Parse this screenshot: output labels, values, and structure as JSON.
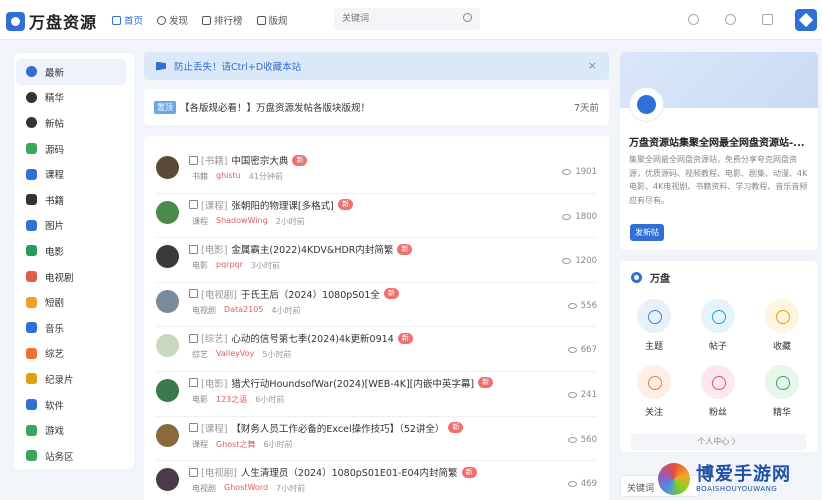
{
  "header": {
    "logo_text": "万盘资源",
    "nav": [
      {
        "label": "首页",
        "icon": "home-icon",
        "active": true
      },
      {
        "label": "发现",
        "icon": "compass-icon"
      },
      {
        "label": "排行榜",
        "icon": "ranking-icon"
      },
      {
        "label": "版规",
        "icon": "rules-icon"
      }
    ],
    "search_placeholder": "关键词",
    "icons": [
      "bell-icon",
      "search-icon",
      "edit-icon",
      "user-avatar-icon"
    ]
  },
  "sidebar": {
    "items": [
      {
        "label": "最新",
        "active": true,
        "color": "#2f6fd6"
      },
      {
        "label": "精华",
        "color": "#333333"
      },
      {
        "label": "新帖",
        "color": "#333333"
      },
      {
        "label": "源码",
        "color": "#3aa55d"
      },
      {
        "label": "课程",
        "color": "#2f6fd6"
      },
      {
        "label": "书籍",
        "color": "#333333"
      },
      {
        "label": "图片",
        "color": "#2f6fd6"
      },
      {
        "label": "电影",
        "color": "#2c9b5a"
      },
      {
        "label": "电视剧",
        "color": "#e25b4b"
      },
      {
        "label": "短剧",
        "color": "#f0a020"
      },
      {
        "label": "音乐",
        "color": "#2f6fd6"
      },
      {
        "label": "综艺",
        "color": "#f07030"
      },
      {
        "label": "纪录片",
        "color": "#e0a010"
      },
      {
        "label": "软件",
        "color": "#2f6fd6"
      },
      {
        "label": "游戏",
        "color": "#3aa55d"
      },
      {
        "label": "站务区",
        "color": "#3aa55d"
      }
    ]
  },
  "notice": {
    "text": "防止丢失！请Ctrl+D收藏本站",
    "close": "×"
  },
  "announcement": {
    "tag": "置顶",
    "text": "【各版规必看！】万盘资源发帖各版块版规！",
    "time": "7天前"
  },
  "posts": [
    {
      "category": "[书籍]",
      "title": "中国密宗大典",
      "badge": "新",
      "section": "书籍",
      "author": "ghistu",
      "time": "41分钟前",
      "views": "1901",
      "avatar_color": "#5a4a3a"
    },
    {
      "category": "[课程]",
      "title": "张朝阳的物理课[多格式]",
      "badge": "新",
      "section": "课程",
      "author": "ShadowWing",
      "time": "2小时前",
      "views": "1800",
      "avatar_color": "#4a8a4a"
    },
    {
      "category": "[电影]",
      "title": "金属霸主(2022)4KDV&HDR内封简繁",
      "badge": "新",
      "section": "电影",
      "author": "pqrpqr",
      "time": "3小时前",
      "views": "1200",
      "avatar_color": "#3a3a3a"
    },
    {
      "category": "[电视剧]",
      "title": "于氏王后（2024）1080pS01全",
      "badge": "新",
      "section": "电视剧",
      "author": "Data2105",
      "time": "4小时前",
      "views": "556",
      "avatar_color": "#7a8a9a"
    },
    {
      "category": "[综艺]",
      "title": "心动的信号第七季(2024)4k更新0914",
      "badge": "新",
      "section": "综艺",
      "author": "ValleyVoy",
      "time": "5小时前",
      "views": "667",
      "avatar_color": "#c8d8c0"
    },
    {
      "category": "[电影]",
      "title": "猎犬行动HoundsofWar(2024)[WEB-4K][内嵌中英字幕]",
      "badge": "新",
      "section": "电影",
      "author": "123之语",
      "time": "6小时前",
      "views": "241",
      "avatar_color": "#3a7a4a"
    },
    {
      "category": "[课程]",
      "title": "【财务人员工作必备的Excel操作技巧】（52讲全）",
      "badge": "新",
      "section": "课程",
      "author": "Ghost之舞",
      "time": "6小时前",
      "views": "560",
      "avatar_color": "#8a6a3a"
    },
    {
      "category": "[电视剧]",
      "title": "人生清理员（2024）1080pS01E01-E04内封简繁",
      "badge": "新",
      "section": "电视剧",
      "author": "GhostWord",
      "time": "7小时前",
      "views": "469",
      "avatar_color": "#4a3a4a"
    }
  ],
  "site_card": {
    "title": "万盘资源站集聚全网最全网盘资源站-...",
    "description": "集聚全网最全网盘资源站，免费分享夸克网盘资源，优质源码、视频教程、电影、剧集、动漫、4K电影、4K电视剧、书籍资料、学习教程、音乐音频应有尽有。",
    "button": "发新帖"
  },
  "wanpan_card": {
    "title": "万盘",
    "items": [
      {
        "label": "主题",
        "icon": "topic-icon",
        "color": "#4a7fd4",
        "bg": "#e8f0fb"
      },
      {
        "label": "帖子",
        "icon": "post-icon",
        "color": "#2c9bd0",
        "bg": "#e4f4fa"
      },
      {
        "label": "收藏",
        "icon": "star-icon",
        "color": "#e0a010",
        "bg": "#fdf5e0"
      },
      {
        "label": "关注",
        "icon": "follow-icon",
        "color": "#f07a30",
        "bg": "#fdefe4"
      },
      {
        "label": "粉丝",
        "icon": "fans-icon",
        "color": "#e0507a",
        "bg": "#fde8ee"
      },
      {
        "label": "精华",
        "icon": "essence-icon",
        "color": "#3aa55d",
        "bg": "#e6f6ea"
      }
    ],
    "center_button": "个人中心 〉"
  },
  "bottom_search": "关键词",
  "watermark": {
    "main": "博爱手游网",
    "sub": "BOAISHOUYOUWANG"
  }
}
